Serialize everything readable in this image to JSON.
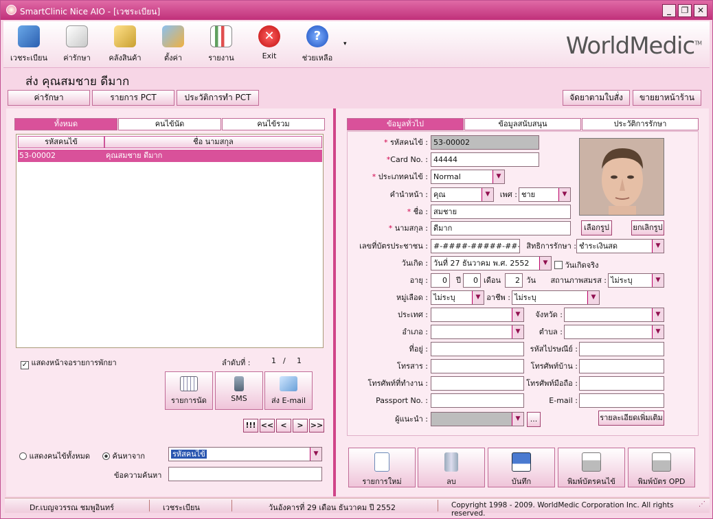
{
  "window": {
    "title": "SmartClinic Nice AIO - [เวชระเบียน]"
  },
  "toolbar": {
    "items": [
      "เวชระเบียน",
      "ค่ารักษา",
      "คลังสินค้า",
      "ตั้งค่า",
      "รายงาน",
      "Exit",
      "ช่วยเหลือ"
    ],
    "brand": "WorldMedic",
    "brand_tm": "TM"
  },
  "patient_header": "ส่ง คุณสมชาย ดีมาก",
  "top_buttons": {
    "left": [
      "ค่ารักษา",
      "รายการ PCT",
      "ประวัติการทำ PCT"
    ],
    "right": [
      "จัดยาตามใบสั่ง",
      "ขายยาหน้าร้าน"
    ]
  },
  "left_tabs": [
    "ทั้งหมด",
    "คนไข้นัด",
    "คนไข้รวม"
  ],
  "list": {
    "headers": [
      "รหัสคนไข้",
      "ชื่อ นามสกุล"
    ],
    "rows": [
      {
        "id": "53-00002",
        "name": "คุณสมชาย ดีมาก"
      }
    ]
  },
  "show_waiting_label": "แสดงหน้าจอรายการพักยา",
  "order": {
    "label": "ลำดับที่ :",
    "current": "1",
    "slash": "/",
    "total": "1"
  },
  "left_buttons": [
    "รายการนัด",
    "SMS",
    "ส่ง E-mail"
  ],
  "nav": [
    "!!!",
    "<<",
    "<",
    ">",
    ">>"
  ],
  "search": {
    "radio_all": "แสดงคนไข้ทั้งหมด",
    "radio_search": "ค้นหาจาก",
    "field_value": "รหัสคนไข้",
    "keyword_label": "ข้อความค้นหา",
    "keyword_value": ""
  },
  "right_tabs": [
    "ข้อมูลทั่วไป",
    "ข้อมูลสนับสนุน",
    "ประวัติการรักษา"
  ],
  "form": {
    "star": "*",
    "hn_label": "รหัสคนไข้ :",
    "hn": "53-00002",
    "card_label": "Card No. :",
    "card": "44444",
    "type_label": "ประเภทคนไข้ :",
    "type": "Normal",
    "prefix_label": "คำนำหน้า :",
    "prefix": "คุณ",
    "sex_label": "เพศ :",
    "sex": "ชาย",
    "fname_label": "ชื่อ :",
    "fname": "สมชาย",
    "lname_label": "นามสกุล :",
    "lname": "ดีมาก",
    "idcard_label": "เลขที่บัตรประชาชน :",
    "idcard": "#-####-#####-##-#",
    "right_label": "สิทธิการรักษา :",
    "right": "ชำระเงินสด",
    "birth_label": "วันเกิด :",
    "birth": "วันที่ 27  ธันวาคม  พ.ศ. 2552",
    "birth_real": "วันเกิดจริง",
    "age_label": "อายุ :",
    "age_y": "0",
    "age_y_unit": "ปี",
    "age_m": "0",
    "age_m_unit": "เดือน",
    "age_d": "2",
    "age_d_unit": "วัน",
    "marital_label": "สถานภาพสมรส :",
    "marital": "ไม่ระบุ",
    "blood_label": "หมู่เลือด :",
    "blood": "ไม่ระบุ",
    "job_label": "อาชีพ :",
    "job": "ไม่ระบุ",
    "country_label": "ประเทศ :",
    "province_label": "จังหวัด :",
    "amphoe_label": "อำเภอ :",
    "tambon_label": "ตำบล :",
    "address_label": "ที่อยู่ :",
    "zip_label": "รหัสไปรษณีย์ :",
    "fax_label": "โทรสาร :",
    "phone_home_label": "โทรศัพท์บ้าน :",
    "phone_work_label": "โทรศัพท์ที่ทำงาน :",
    "mobile_label": "โทรศัพท์มือถือ :",
    "passport_label": "Passport No. :",
    "email_label": "E-mail :",
    "referrer_label": "ผู้แนะนำ :",
    "browse": "...",
    "photo_select": "เลือกรูป",
    "photo_cancel": "ยกเลิกรูป",
    "more_detail": "รายละเอียดเพิ่มเติม"
  },
  "actions": [
    "รายการใหม่",
    "ลบ",
    "บันทึก",
    "พิมพ์บัตรคนไข้",
    "พิมพ์บัตร OPD"
  ],
  "status": {
    "user": "Dr.เบญจวรรณ ชมพูอินทร์",
    "module": "เวชระเบียน",
    "date": "วันอังคารที่ 29  เดือน ธันวาคม  ปี 2552",
    "copyright": "Copyright 1998 - 2009. WorldMedic Corporation Inc. All rights reserved."
  }
}
